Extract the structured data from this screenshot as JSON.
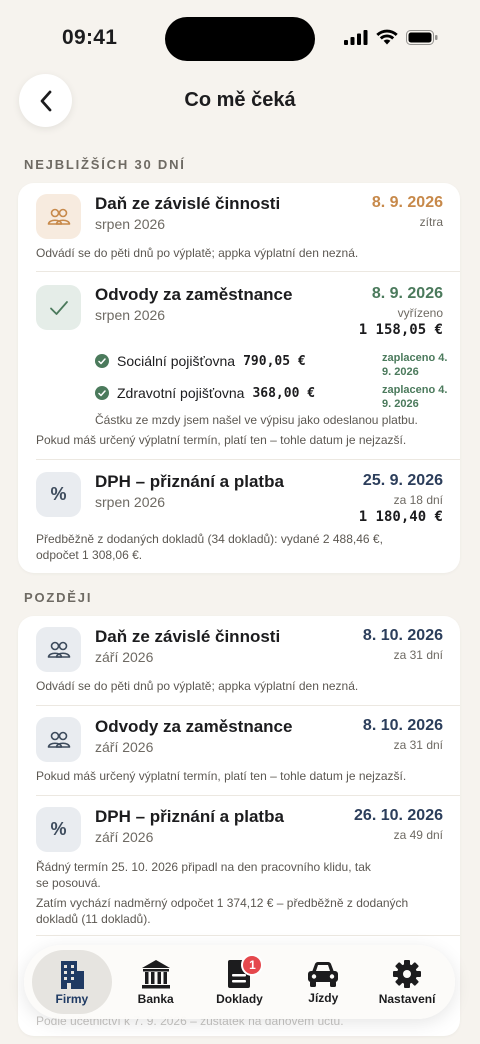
{
  "status": {
    "time": "09:41"
  },
  "header": {
    "title": "Co mě čeká"
  },
  "sections": {
    "soon_label": "NEJBLIŽŠÍCH 30 DNÍ",
    "later_label": "POZDĚJI"
  },
  "soon": {
    "tax": {
      "icon": "people-icon",
      "title": "Daň ze závislé činnosti",
      "subtitle": "srpen 2026",
      "date": "8. 9. 2026",
      "relative": "zítra",
      "note": "Odvádí se do pěti dnů po výplatě; appka výplatní den nezná."
    },
    "levies": {
      "icon": "check-icon",
      "title": "Odvody za zaměstnance",
      "subtitle": "srpen 2026",
      "date": "8. 9. 2026",
      "relative": "vyřízeno",
      "amount": "1 158,05 €",
      "social": {
        "label": "Sociální pojišťovna",
        "amount": "790,05 €",
        "paid_line1": "zaplaceno 4.",
        "paid_line2": "9. 2026"
      },
      "health": {
        "label": "Zdravotní pojišťovna",
        "amount": "368,00 €",
        "paid_line1": "zaplaceno 4.",
        "paid_line2": "9. 2026"
      },
      "note_found": "Částku ze mzdy jsem našel ve výpisu jako odeslanou platbu.",
      "note": "Pokud máš určený výplatní termín, platí ten – tohle datum je nejzazší."
    },
    "vat": {
      "icon": "percent-icon",
      "title": "DPH – přiznání a platba",
      "subtitle": "srpen 2026",
      "date": "25. 9. 2026",
      "relative": "za 18 dní",
      "amount": "1 180,40 €",
      "note_line1": "Předběžně z dodaných dokladů (34 dokladů): vydané 2 488,46 €,",
      "note_line2": "odpočet 1 308,06 €."
    }
  },
  "later": {
    "tax": {
      "title": "Daň ze závislé činnosti",
      "subtitle": "září 2026",
      "date": "8. 10. 2026",
      "relative": "za 31 dní",
      "note": "Odvádí se do pěti dnů po výplatě; appka výplatní den nezná."
    },
    "levies": {
      "title": "Odvody za zaměstnance",
      "subtitle": "září 2026",
      "date": "8. 10. 2026",
      "relative": "za 31 dní",
      "note": "Pokud máš určený výplatní termín, platí ten – tohle datum je nejzazší."
    },
    "vat": {
      "title": "DPH – přiznání a platba",
      "subtitle": "září 2026",
      "date": "26. 10. 2026",
      "relative": "za 49 dní",
      "note_line1": "Řádný termín 25. 10. 2026 připadl na den pracovního klidu, tak",
      "note_line2": "se posouvá.",
      "note_line3": "Zatím vychází nadměrný odpočet 1 374,12 € – předběžně z dodaných",
      "note_line4": "dokladů (11 dokladů)."
    },
    "peek_note": "Podle účetnictví k 7. 9. 2026 – zůstatek na daňovém účtu."
  },
  "tabbar": {
    "tabs": [
      {
        "label": "Firmy",
        "icon": "building-icon",
        "active": true
      },
      {
        "label": "Banka",
        "icon": "bank-icon",
        "active": false
      },
      {
        "label": "Doklady",
        "icon": "document-icon",
        "active": false,
        "badge": "1"
      },
      {
        "label": "Jízdy",
        "icon": "car-icon",
        "active": false
      },
      {
        "label": "Nastavení",
        "icon": "gear-icon",
        "active": false
      }
    ]
  }
}
